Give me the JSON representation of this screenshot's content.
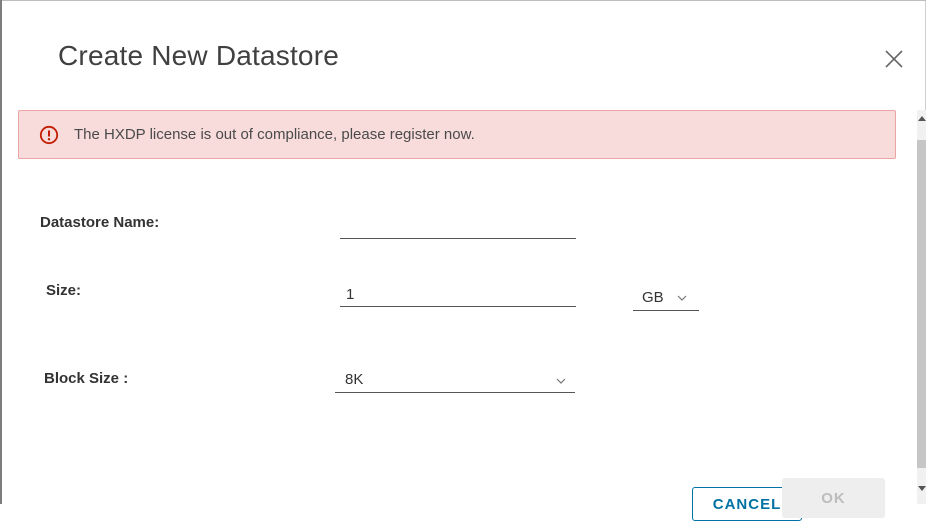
{
  "dialog": {
    "title": "Create New Datastore"
  },
  "alert": {
    "message": "The HXDP license is out of compliance, please register now."
  },
  "form": {
    "datastore_name": {
      "label": "Datastore Name:",
      "value": ""
    },
    "size": {
      "label": "Size:",
      "value": "1",
      "unit": "GB"
    },
    "block_size": {
      "label": "Block Size :",
      "value": "8K"
    }
  },
  "footer": {
    "cancel_label": "CANCEL",
    "ok_label": "OK"
  },
  "icons": {
    "close": "close-icon",
    "alert": "alert-circle-icon",
    "chevron": "chevron-down-icon"
  },
  "colors": {
    "alert_bg": "#f8dcdc",
    "alert_border": "#eca4a4",
    "alert_icon": "#c21d00",
    "primary": "#0072a3"
  }
}
